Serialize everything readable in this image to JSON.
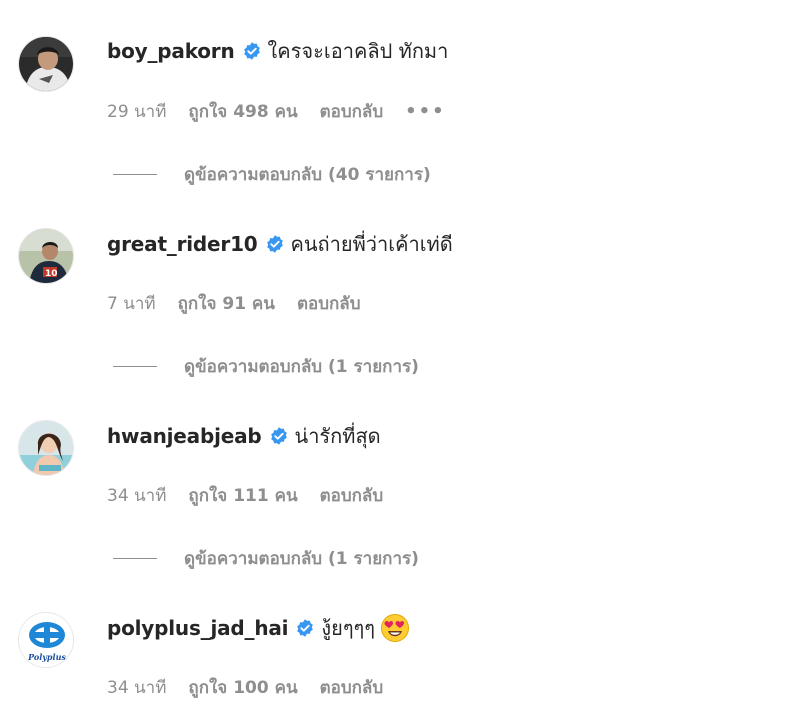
{
  "comments": [
    {
      "username": "boy_pakorn",
      "text": "ใครจะเอาคลิป ทักมา",
      "time": "29 นาที",
      "likes": "ถูกใจ 498 คน",
      "reply": "ตอบกลับ",
      "more": "•••",
      "view_replies": "ดูข้อความตอบกลับ (40 รายการ)"
    },
    {
      "username": "great_rider10",
      "text": "คนถ่ายพี่ว่าเค้าเท่ดี",
      "time": "7 นาที",
      "likes": "ถูกใจ 91 คน",
      "reply": "ตอบกลับ",
      "view_replies": "ดูข้อความตอบกลับ (1 รายการ)"
    },
    {
      "username": "hwanjeabjeab",
      "text": "น่ารักที่สุด",
      "time": "34 นาที",
      "likes": "ถูกใจ 111 คน",
      "reply": "ตอบกลับ",
      "view_replies": "ดูข้อความตอบกลับ (1 รายการ)"
    },
    {
      "username": "polyplus_jad_hai",
      "text": "งู้ยๆๆๆ",
      "emoji": "heart-eyes-emoji",
      "time": "34 นาที",
      "likes": "ถูกใจ 100 คน",
      "reply": "ตอบกลับ"
    }
  ],
  "colors": {
    "verified": "#3897f0",
    "meta_text": "#8e8e8e",
    "primary_text": "#262626"
  },
  "avatars": {
    "boy_pakorn": "person-in-white-shirt",
    "great_rider10": "rider-in-red-jersey",
    "hwanjeabjeab": "woman-at-pool",
    "polyplus_jad_hai": "polyplus-logo"
  },
  "brand": {
    "polyplus_logo_text": "Polyplus"
  }
}
